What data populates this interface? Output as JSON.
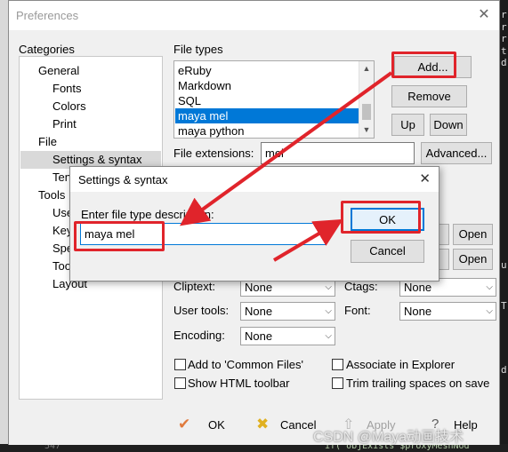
{
  "prefs": {
    "title": "Preferences",
    "categories_label": "Categories",
    "tree": [
      "General",
      "Fonts",
      "Colors",
      "Print",
      "File",
      "Settings & syntax",
      "Templates",
      "Tools",
      "Use",
      "Key",
      "Spe",
      "Too",
      "Layout"
    ],
    "tree_visible": [
      "General",
      "Fonts",
      "Colors",
      "Print",
      "File",
      "Settings & syntax",
      "Ten",
      "Tools",
      "Use",
      "Key",
      "Spe",
      "Too",
      "Layout"
    ],
    "file_types_label": "File types",
    "file_types": [
      "eRuby",
      "Markdown",
      "SQL",
      "maya mel",
      "maya python"
    ],
    "selected_file_type": "maya mel",
    "buttons": {
      "add": "Add...",
      "remove": "Remove",
      "up": "Up",
      "down": "Down",
      "advanced": "Advanced...",
      "open1": "Open",
      "open2": "Open"
    },
    "file_extensions_label": "File extensions:",
    "file_extensions_value": "mel",
    "cliptext_label": "Cliptext:",
    "cliptext_value": "None",
    "ctags_label": "Ctags:",
    "ctags_value": "None",
    "user_tools_label": "User tools:",
    "user_tools_value": "None",
    "font_label": "Font:",
    "font_value": "None",
    "encoding_label": "Encoding:",
    "encoding_value": "None",
    "checkboxes": {
      "add_common": "Add to 'Common Files'",
      "associate": "Associate in Explorer",
      "show_html": "Show HTML toolbar",
      "trim": "Trim trailing spaces on save"
    },
    "footer": {
      "ok": "OK",
      "cancel": "Cancel",
      "apply": "Apply",
      "help": "Help"
    }
  },
  "dialog": {
    "title": "Settings & syntax",
    "prompt": "Enter file type description:",
    "value": "maya mel",
    "ok": "OK",
    "cancel": "Cancel"
  },
  "background": {
    "line_number": "547",
    "code_snippet": "if(`objExists $proxyMeshNod",
    "right_chars": [
      "r",
      "r",
      "r",
      "t",
      "d",
      "u",
      "T",
      "d"
    ]
  },
  "watermark": "CSDN @Maya动画技术",
  "colors": {
    "selection": "#0078d7",
    "highlight": "#e0242b",
    "ok_icon": "#e07a3c",
    "cancel_icon": "#e0b020"
  }
}
